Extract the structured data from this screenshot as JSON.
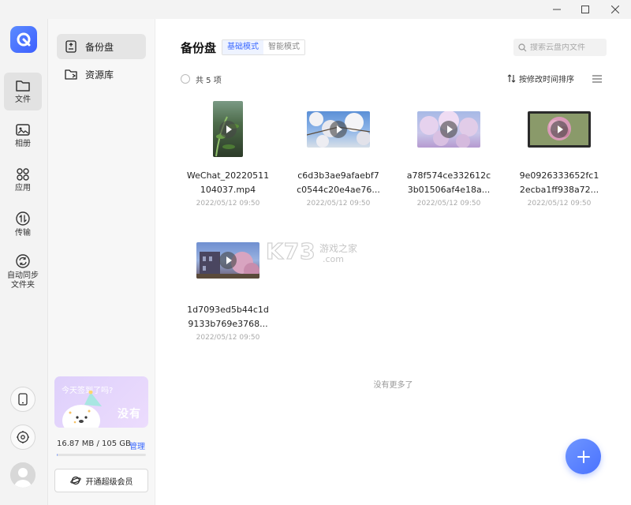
{
  "nav": {
    "items": [
      {
        "id": "files",
        "label": "文件",
        "icon": "folder-icon"
      },
      {
        "id": "album",
        "label": "相册",
        "icon": "image-icon"
      },
      {
        "id": "apps",
        "label": "应用",
        "icon": "apps-grid-icon"
      },
      {
        "id": "transfer",
        "label": "传输",
        "icon": "transfer-icon"
      },
      {
        "id": "sync",
        "label": "自动同步文件夹",
        "label_lines": [
          "自动同步",
          "文件夹"
        ],
        "icon": "sync-icon"
      }
    ],
    "active": "files"
  },
  "sidebar": {
    "items": [
      {
        "label": "备份盘",
        "icon": "backup-drive-icon"
      },
      {
        "label": "资源库",
        "icon": "library-folder-icon"
      }
    ],
    "active_index": 0,
    "promo": {
      "title": "今天签到了吗?",
      "cta": "没有"
    },
    "storage": {
      "text": "16.87 MB / 105 GB",
      "used_fraction": 0.0002,
      "manage_label": "管理"
    },
    "vip_button": "开通超级会员"
  },
  "main": {
    "title": "备份盘",
    "modes": [
      {
        "label": "基础模式",
        "active": true
      },
      {
        "label": "智能模式",
        "active": false
      }
    ],
    "search_placeholder": "搜索云盘内文件",
    "count_text": "共 5 项",
    "sort_label": "按修改时间排序",
    "files": [
      {
        "name_lines": [
          "WeChat_20220511",
          "104037.mp4"
        ],
        "date": "2022/05/12 09:50",
        "orientation": "portrait"
      },
      {
        "name_lines": [
          "c6d3b3ae9afaebf7",
          "c0544c20e4ae76..."
        ],
        "date": "2022/05/12 09:50",
        "orientation": "landscape"
      },
      {
        "name_lines": [
          "a78f574ce332612c",
          "3b01506af4e18a..."
        ],
        "date": "2022/05/12 09:50",
        "orientation": "landscape"
      },
      {
        "name_lines": [
          "9e0926333652fc1",
          "2ecba1ff938a72..."
        ],
        "date": "2022/05/12 09:50",
        "orientation": "landscape"
      },
      {
        "name_lines": [
          "1d7093ed5b44c1d",
          "9133b769e3768..."
        ],
        "date": "2022/05/12 09:50",
        "orientation": "landscape"
      }
    ],
    "no_more_text": "没有更多了"
  },
  "watermark": {
    "text": "K73",
    "sub": "游戏之家",
    "domain": ".com"
  },
  "colors": {
    "accent": "#4a72ff",
    "link": "#3d6bff",
    "promo_bg": "#e4d6fc"
  }
}
